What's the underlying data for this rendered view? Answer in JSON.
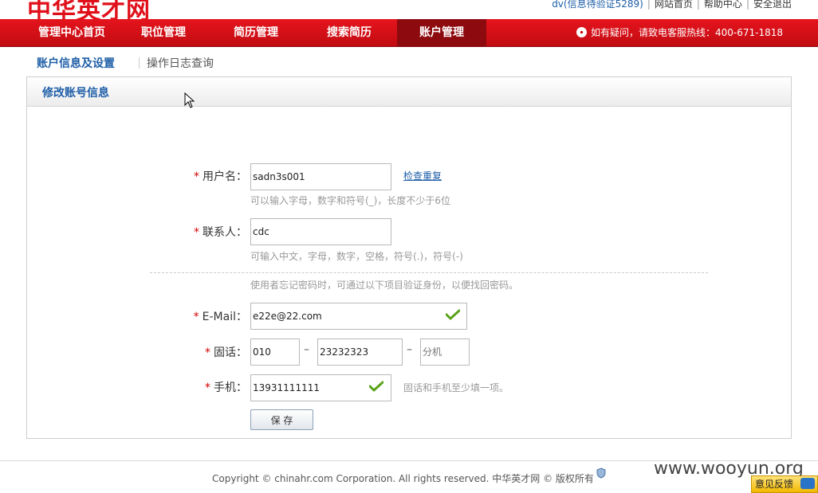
{
  "header": {
    "logo_text": "中华英才网",
    "user_text": "dv(信息待验证5289)",
    "links": [
      "网站首页",
      "帮助中心",
      "安全退出"
    ]
  },
  "nav": {
    "items": [
      "管理中心首页",
      "职位管理",
      "简历管理",
      "搜索简历",
      "账户管理"
    ],
    "active_index": 4,
    "hotline": "如有疑问，请致电客服热线：400-671-1818"
  },
  "subtabs": {
    "active": "账户信息及设置",
    "other": "操作日志查询"
  },
  "panel": {
    "title": "修改账号信息"
  },
  "form": {
    "required_mark": "*",
    "username": {
      "label": "用户名：",
      "value": "sadn3s001",
      "check_link": "检查重复",
      "hint": "可以输入字母，数字和符号(_)，长度不少于6位"
    },
    "contact": {
      "label": "联系人：",
      "value": "cdc",
      "hint": "可输入中文，字母，数字，空格，符号(.)，符号(-)"
    },
    "recover_hint": "使用者忘记密码时，可通过以下项目验证身份，以便找回密码。",
    "email": {
      "label": "E-Mail：",
      "value": "e22e@22.com"
    },
    "phone": {
      "label": "固话：",
      "area": "010",
      "number": "23232323",
      "ext_placeholder": "分机",
      "dash": "–"
    },
    "mobile": {
      "label": "手机：",
      "value": "13931111111",
      "hint": "固话和手机至少填一项。"
    },
    "save_label": "保 存"
  },
  "footer": {
    "copyright": "Copyright © chinahr.com Corporation. All rights reserved. 中华英才网 © 版权所有",
    "watermark": "www.wooyun.org",
    "feedback": "意见反馈"
  },
  "colors": {
    "nav_red": "#e5141d",
    "nav_active": "#8d0a0f",
    "link_blue": "#1f5fa8",
    "required_red": "#d40000",
    "check_green": "#5aa21a"
  }
}
